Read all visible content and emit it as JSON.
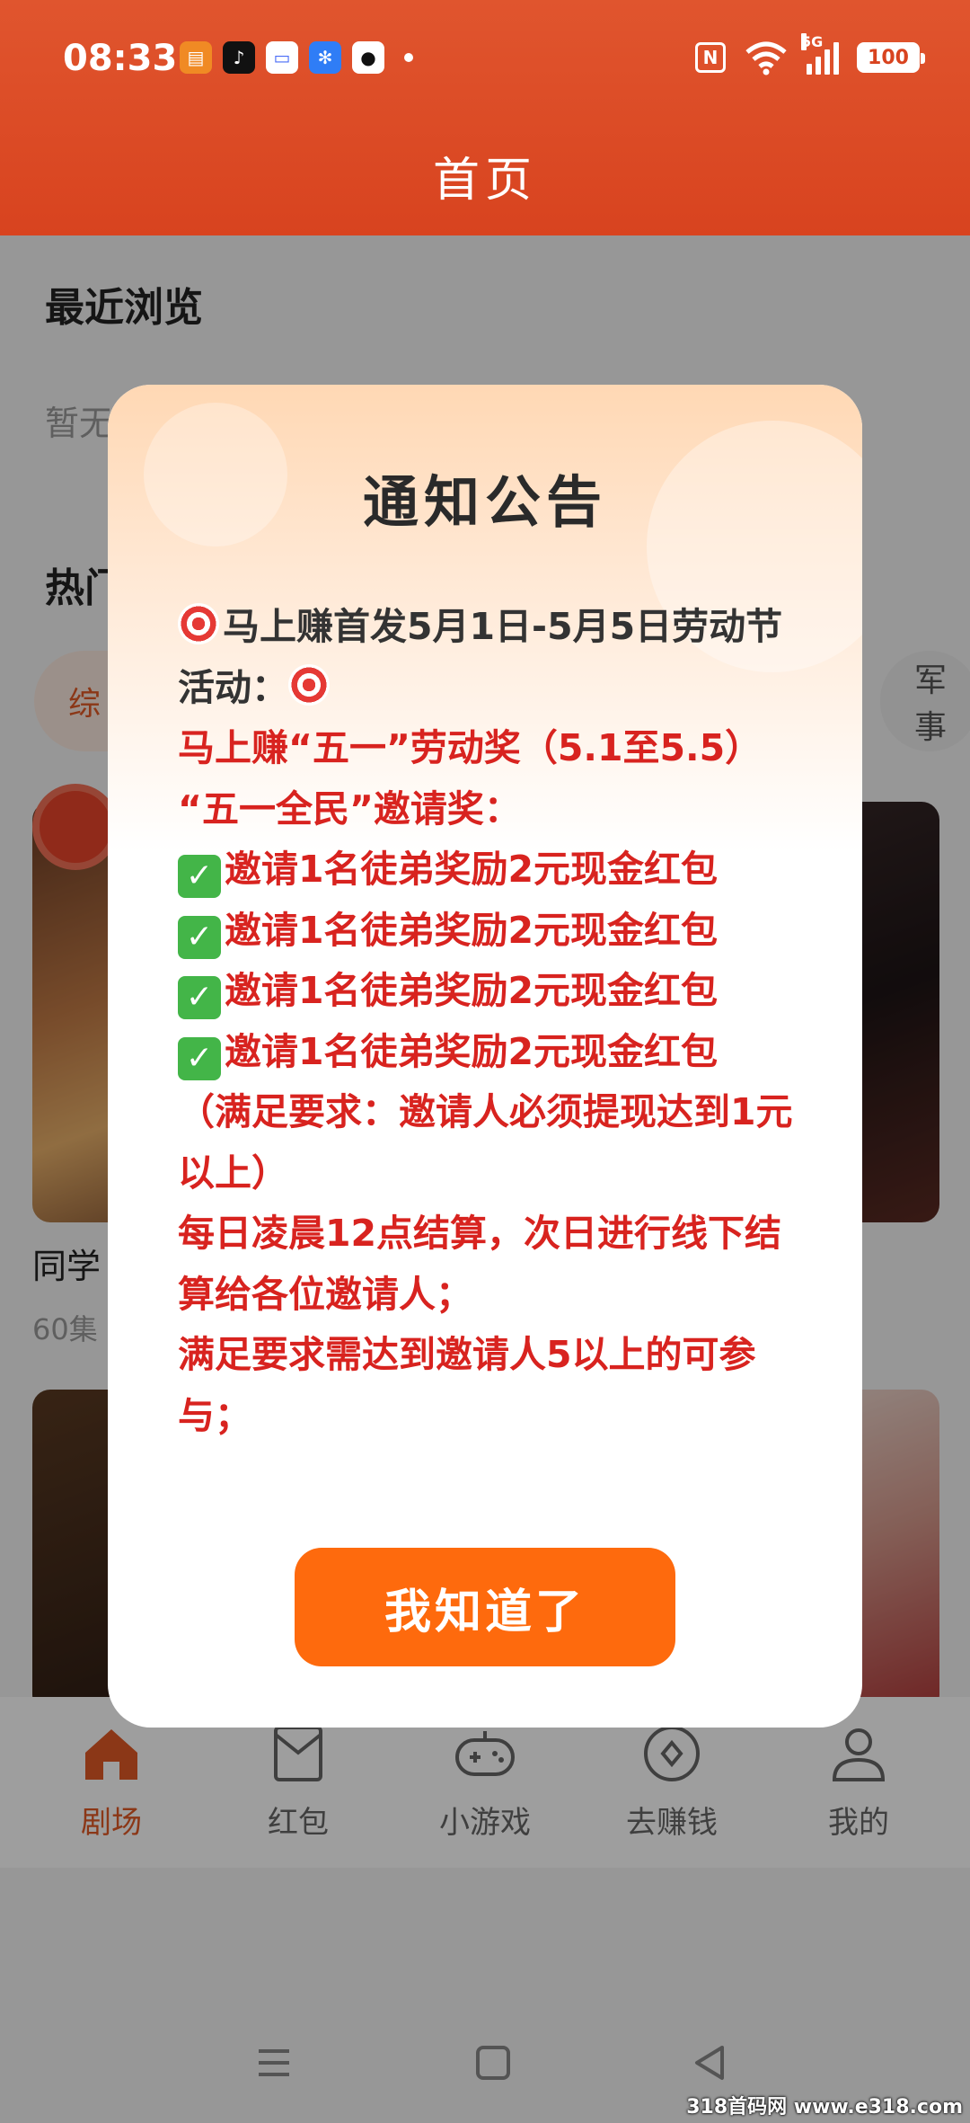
{
  "status": {
    "time": "08:33",
    "signal_label": "5G",
    "battery": "100"
  },
  "header": {
    "title": "首页"
  },
  "recent": {
    "title": "最近浏览",
    "empty": "暂无"
  },
  "hot": {
    "title": "热门",
    "chips": [
      "综",
      "军事"
    ]
  },
  "cards": [
    {
      "title": "同学",
      "meta": "60集"
    }
  ],
  "nav": {
    "items": [
      {
        "label": "剧场",
        "active": true
      },
      {
        "label": "红包",
        "active": false
      },
      {
        "label": "小游戏",
        "active": false
      },
      {
        "label": "去赚钱",
        "active": false
      },
      {
        "label": "我的",
        "active": false
      }
    ]
  },
  "modal": {
    "title": "通知公告",
    "intro_1": "马上赚首发5月1日-5月5日劳动节活动：",
    "line_award": "马上赚“五一”劳动奖（5.1至5.5）",
    "line_invite": "“五一全民”邀请奖：",
    "rewards": [
      "邀请1名徒弟奖励2元现金红包",
      "邀请1名徒弟奖励2元现金红包",
      "邀请1名徒弟奖励2元现金红包",
      "邀请1名徒弟奖励2元现金红包"
    ],
    "requirement": "（满足要求：邀请人必须提现达到1元以上）",
    "settle": "每日凌晨12点结算，次日进行线下结算给各位邀请人；",
    "condition": "满足要求需达到邀请人5以上的可参与；",
    "ok_button": "我知道了"
  },
  "watermark": "318首码网 www.e318.com",
  "colors": {
    "header": "#d8431f",
    "accent": "#fe6a0d",
    "text_red": "#d8231f"
  }
}
